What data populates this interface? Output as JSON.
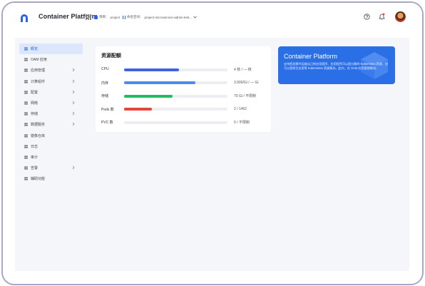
{
  "header": {
    "app_title": "Container Platform",
    "project_label": "项目：",
    "project_value": "project",
    "namespace_label": "命名空间：",
    "namespace_value": "project-microservice-admin-test..."
  },
  "sidebar": {
    "items": [
      {
        "label": "概览",
        "icon": "overview-icon",
        "active": true,
        "expandable": false
      },
      {
        "label": "OAM 应用",
        "icon": "oam-app-icon",
        "active": false,
        "expandable": false
      },
      {
        "label": "应用管理",
        "icon": "app-management-icon",
        "active": false,
        "expandable": true
      },
      {
        "label": "计算组件",
        "icon": "compute-icon",
        "active": false,
        "expandable": true
      },
      {
        "label": "配置",
        "icon": "config-icon",
        "active": false,
        "expandable": true
      },
      {
        "label": "网络",
        "icon": "network-icon",
        "active": false,
        "expandable": true
      },
      {
        "label": "存储",
        "icon": "storage-icon",
        "active": false,
        "expandable": true
      },
      {
        "label": "数据服务",
        "icon": "data-service-icon",
        "active": false,
        "expandable": true
      },
      {
        "label": "镜像仓库",
        "icon": "image-registry-icon",
        "active": false,
        "expandable": false
      },
      {
        "label": "日志",
        "icon": "log-icon",
        "active": false,
        "expandable": false
      },
      {
        "label": "审计",
        "icon": "audit-icon",
        "active": false,
        "expandable": false
      },
      {
        "label": "告警",
        "icon": "alert-icon",
        "active": false,
        "expandable": true
      },
      {
        "label": "辅助功能",
        "icon": "accessibility-icon",
        "active": false,
        "expandable": false
      }
    ]
  },
  "resources": {
    "title": "资源配额",
    "rows": [
      {
        "label": "CPU",
        "value": "4 核 / — 核",
        "fraction": 0.53,
        "color": "#3e63dd"
      },
      {
        "label": "内存",
        "value": "3,900/Gi / — Gi",
        "fraction": 0.69,
        "color": "#4a8cf0"
      },
      {
        "label": "存储",
        "value": "70 Gi / 不限制",
        "fraction": 0.47,
        "color": "#1fbd5f"
      },
      {
        "label": "Pods 数",
        "value": "2 / 1462",
        "fraction": 0.27,
        "color": "#e5443a"
      },
      {
        "label": "PVC 数",
        "value": "0 / 不限制",
        "fraction": 0,
        "color": "#e5443a"
      }
    ]
  },
  "promo": {
    "title": "Container Platform",
    "description": "支持您创建并运维自己的应用程序、应用程序可以是分散的 Kubernetes 资源、也可以是原生应用等 Kubernetes 资源集合。此外，在 OAM 应用管理模块..."
  },
  "colors": {
    "accent": "#2e63e7",
    "promo_bg": "#2b6fe6",
    "content_bg": "#f5f6fa",
    "frame_border": "#a8a8c4"
  }
}
